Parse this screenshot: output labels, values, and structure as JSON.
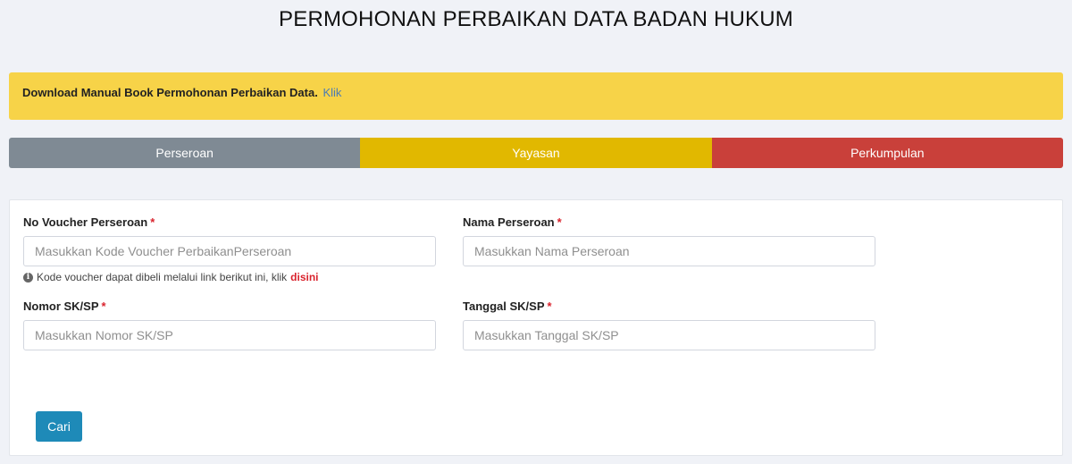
{
  "page": {
    "title": "PERMOHONAN PERBAIKAN DATA BADAN HUKUM"
  },
  "notice": {
    "text": "Download Manual Book Permohonan Perbaikan Data.",
    "link_label": "Klik"
  },
  "tabs": [
    {
      "label": "Perseroan",
      "color": "#7f8a94"
    },
    {
      "label": "Yayasan",
      "color": "#e1b800"
    },
    {
      "label": "Perkumpulan",
      "color": "#c9403a"
    }
  ],
  "form": {
    "voucher": {
      "label": "No Voucher Perseroan",
      "required_mark": "*",
      "placeholder": "Masukkan Kode Voucher PerbaikanPerseroan",
      "value": ""
    },
    "name": {
      "label": "Nama Perseroan",
      "required_mark": "*",
      "placeholder": "Masukkan Nama Perseroan",
      "value": ""
    },
    "sk_number": {
      "label": "Nomor SK/SP",
      "required_mark": "*",
      "placeholder": "Masukkan Nomor SK/SP",
      "value": ""
    },
    "sk_date": {
      "label": "Tanggal SK/SP",
      "required_mark": "*",
      "placeholder": "Masukkan Tanggal SK/SP",
      "value": ""
    },
    "help": {
      "icon": "info-icon",
      "text": "Kode voucher dapat dibeli melalui link berikut ini, klik",
      "link_label": "disini"
    },
    "submit_label": "Cari"
  },
  "colors": {
    "accent": "#1e8ab8",
    "notice_bg": "#f7d348",
    "required": "#d9232d"
  }
}
